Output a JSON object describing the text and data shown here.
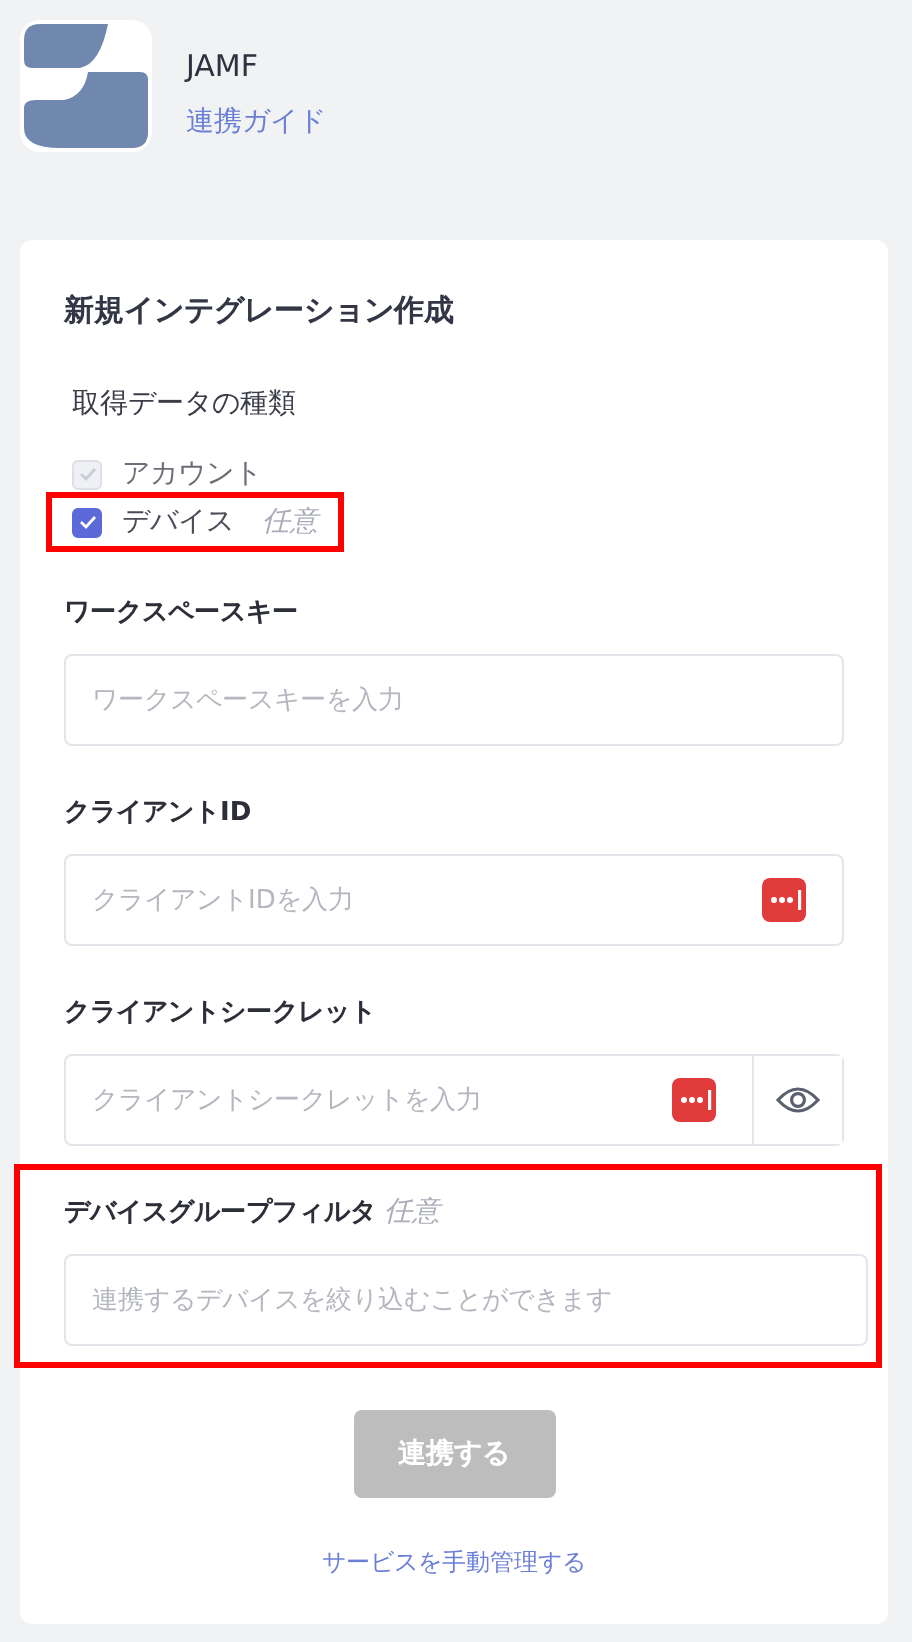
{
  "header": {
    "title": "JAMF",
    "guide_link": "連携ガイド"
  },
  "form": {
    "title": "新規インテグレーション作成",
    "data_types": {
      "label": "取得データの種類",
      "options": [
        {
          "label": "アカウント",
          "checked": true,
          "disabled": true,
          "highlighted": false
        },
        {
          "label": "デバイス",
          "optional": "任意",
          "checked": true,
          "disabled": false,
          "highlighted": true
        }
      ]
    },
    "fields": [
      {
        "kind": "plain",
        "label": "ワークスペースキー",
        "placeholder": "ワークスペースキーを入力",
        "highlighted": false
      },
      {
        "kind": "password-manager",
        "label": "クライアントID",
        "placeholder": "クライアントIDを入力",
        "highlighted": false
      },
      {
        "kind": "secret",
        "label": "クライアントシークレット",
        "placeholder": "クライアントシークレットを入力",
        "highlighted": false
      },
      {
        "kind": "plain",
        "label": "デバイスグループフィルタ",
        "optional": "任意",
        "placeholder": "連携するデバイスを絞り込むことができます",
        "highlighted": true
      }
    ],
    "submit": {
      "label": "連携する",
      "disabled": true
    },
    "manual_link": "サービスを手動管理する"
  }
}
